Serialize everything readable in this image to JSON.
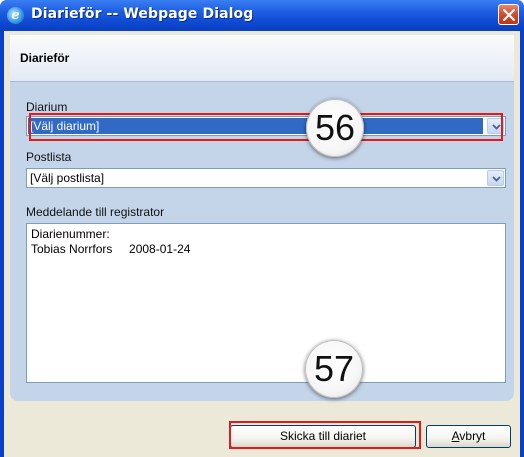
{
  "window": {
    "title": "Diarieför -- Webpage Dialog",
    "icon": "ie-icon"
  },
  "panel": {
    "title": "Diarieför"
  },
  "form": {
    "diarium": {
      "label": "Diarium",
      "selected": "[Välj diarium]"
    },
    "postlista": {
      "label": "Postlista",
      "selected": "[Välj postlista]"
    },
    "meddelande": {
      "label": "Meddelande till registrator",
      "value": "Diarienummer:\nTobias Norrfors     2008-01-24"
    }
  },
  "buttons": {
    "submit_label": "Skicka till diariet",
    "cancel_label": "Avbryt"
  },
  "annotations": {
    "badge_1": "56",
    "badge_2": "57",
    "highlight_color": "#e21a1a"
  },
  "colors": {
    "titlebar": "#0d48d0",
    "panel": "#c4d4e9",
    "selection": "#316ac5",
    "dialog_bg": "#ece9d8"
  }
}
